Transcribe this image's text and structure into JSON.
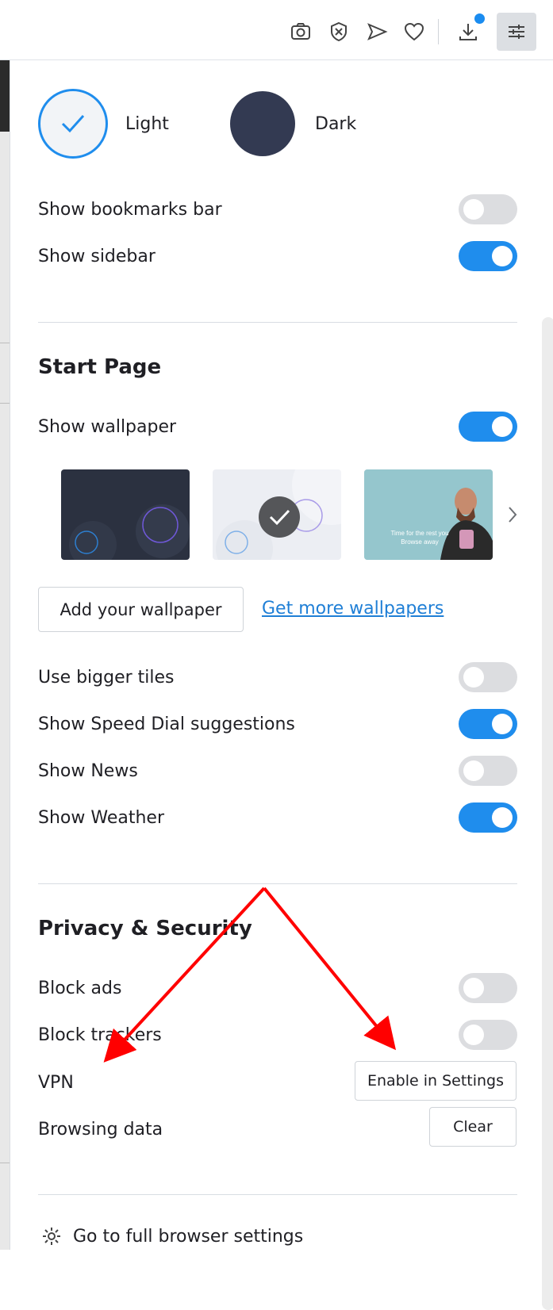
{
  "colors": {
    "accent": "#1f8ded",
    "toggle_off": "#dcdde0",
    "dark_theme": "#333a52",
    "link": "#1f7fd6",
    "badge": "#1a8cf0",
    "settings_bg": "#dcdfe3",
    "annotation": "#ff0000"
  },
  "toolbar": {
    "icons": [
      "camera-icon",
      "shield-block-icon",
      "send-icon",
      "heart-icon",
      "download-icon",
      "settings-sliders-icon"
    ]
  },
  "theme": {
    "light_label": "Light",
    "dark_label": "Dark",
    "selected": "light"
  },
  "appearance": {
    "show_bookmarks_bar": {
      "label": "Show bookmarks bar",
      "on": false
    },
    "show_sidebar": {
      "label": "Show sidebar",
      "on": true
    }
  },
  "start_page": {
    "title": "Start Page",
    "show_wallpaper": {
      "label": "Show wallpaper",
      "on": true
    },
    "wallpapers": [
      {
        "name": "dark-abstract",
        "selected": false
      },
      {
        "name": "light-abstract",
        "selected": true
      },
      {
        "name": "man-photo",
        "selected": false,
        "caption": "Time for the rest you\nBrowse away"
      }
    ],
    "add_wallpaper_label": "Add your wallpaper",
    "get_more_label": "Get more wallpapers",
    "use_bigger_tiles": {
      "label": "Use bigger tiles",
      "on": false
    },
    "show_speed_dial": {
      "label": "Show Speed Dial suggestions",
      "on": true
    },
    "show_news": {
      "label": "Show News",
      "on": false
    },
    "show_weather": {
      "label": "Show Weather",
      "on": true
    }
  },
  "privacy": {
    "title": "Privacy & Security",
    "block_ads": {
      "label": "Block ads",
      "on": false
    },
    "block_trackers": {
      "label": "Block trackers",
      "on": false
    },
    "vpn_label": "VPN",
    "vpn_button": "Enable in Settings",
    "browsing_data_label": "Browsing data",
    "clear_button": "Clear"
  },
  "footer": {
    "settings_link": "Go to full browser settings"
  }
}
